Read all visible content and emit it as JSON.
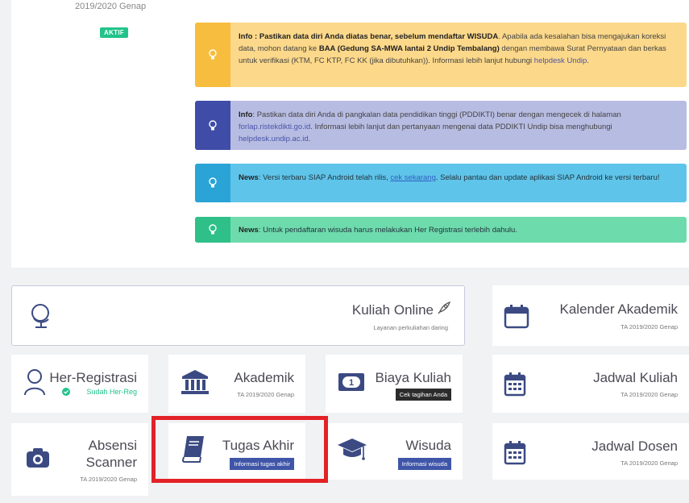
{
  "profile": {
    "semester": "2019/2020 Genap",
    "status_badge": "AKTIF"
  },
  "alerts": {
    "yellow": {
      "bold_prefix": "Info : Pastikan data diri Anda diatas benar, sebelum mendaftar WISUDA",
      "text_a": ". Apabila ada kesalahan bisa mengajukan koreksi data, mohon datang ke ",
      "bold_place": "BAA (Gedung SA-MWA lantai 2 Undip Tembalang)",
      "text_b": " dengan membawa Surat Pernyataan dan berkas untuk verifikasi (KTM, FC KTP, FC KK (jika dibutuhkan)). Informasi lebih lanjut hubungi ",
      "link": "helpdesk Undip",
      "end": "."
    },
    "blue": {
      "bold_prefix": "Info",
      "text_a": ": Pastikan data diri Anda di pangkalan data pendidikan tinggi (PDDIKTI) benar dengan mengecek di halaman ",
      "link1": "forlap.ristekdikti.go.id",
      "text_b": ". Informasi lebih lanjut dan pertanyaan mengenai data PDDIKTI Undip bisa menghubungi ",
      "link2": "helpdesk.undip.ac.id",
      "end": "."
    },
    "cyan": {
      "bold_prefix": "News",
      "text_a": ": Versi terbaru SIAP Android telah rilis, ",
      "link": "cek sekarang",
      "text_b": ". Selalu pantau dan update aplikasi SIAP Android ke versi terbaru!"
    },
    "green": {
      "bold_prefix": "News",
      "text_a": ": Untuk pendaftaran wisuda harus melakukan Her Registrasi terlebih dahulu."
    }
  },
  "cards": {
    "kuliah_online": {
      "title": "Kuliah Online",
      "sub": "Layanan perkuliahan daring"
    },
    "kalender": {
      "title": "Kalender Akademik",
      "sub": "TA 2019/2020 Genap"
    },
    "her_registrasi": {
      "title": "Her-Registrasi",
      "sub": "Sudah Her-Reg"
    },
    "akademik": {
      "title": "Akademik",
      "sub": "TA 2019/2020 Genap"
    },
    "biaya": {
      "title": "Biaya Kuliah",
      "badge": "Cek tagihan Anda"
    },
    "jadwal_kuliah": {
      "title": "Jadwal Kuliah",
      "sub": "TA 2019/2020 Genap"
    },
    "absensi": {
      "title_line1": "Absensi",
      "title_line2": "Scanner",
      "sub": "TA 2019/2020 Genap"
    },
    "tugas_akhir": {
      "title": "Tugas Akhir",
      "badge": "Informasi tugas akhir"
    },
    "wisuda": {
      "title": "Wisuda",
      "badge": "Informasi wisuda"
    },
    "jadwal_dosen": {
      "title": "Jadwal Dosen",
      "sub": "TA 2019/2020 Genap"
    }
  },
  "colors": {
    "icon": "#3b4a82",
    "green": "#21c38a",
    "badge_blue": "#3f55a8",
    "badge_dark": "#2c2c2c",
    "highlight": "#e22227"
  },
  "icons": [
    "bulb-icon",
    "globe-icon",
    "rocket-icon",
    "calendar-icon",
    "user-icon",
    "check-circle-icon",
    "bank-icon",
    "money-icon",
    "camera-icon",
    "book-icon",
    "graduation-cap-icon"
  ]
}
